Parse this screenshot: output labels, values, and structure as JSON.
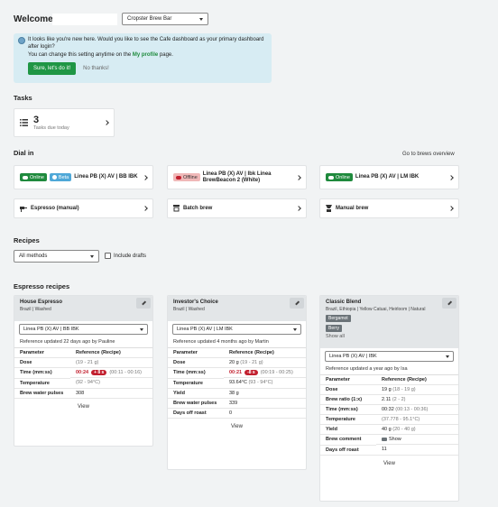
{
  "header": {
    "welcome": "Welcome",
    "location_select": "Cropster Brew Bar"
  },
  "banner": {
    "text1": "It looks like you're new here. Would you like to see the Cafe dashboard as your primary dashboard after login?",
    "text2_prefix": "You can change this setting anytime on the",
    "text2_link": "My profile",
    "text2_suffix": "page.",
    "accept_button": "Sure, let's do it!",
    "decline_button": "No thanks!"
  },
  "tasks": {
    "title": "Tasks",
    "count": "3",
    "label": "Tasks due today"
  },
  "dial_in": {
    "title": "Dial in",
    "overview_link": "Go to brews overview",
    "devices": [
      {
        "badges": [
          "Online",
          "Beta"
        ],
        "name": "Linea PB (X) AV | BB IBK"
      },
      {
        "badges": [
          "Offline"
        ],
        "name": "Linea PB (X) AV | Ibk Linea BrewBeacon 2 (White)"
      },
      {
        "badges": [
          "Online"
        ],
        "name": "Linea PB (X) AV | LM IBK"
      }
    ],
    "manual": [
      {
        "label": "Espresso (manual)"
      },
      {
        "label": "Batch brew"
      },
      {
        "label": "Manual brew"
      }
    ]
  },
  "recipes": {
    "title": "Recipes",
    "filter_select": "All methods",
    "include_drafts": "Include drafts"
  },
  "espresso_recipes": {
    "title": "Espresso recipes",
    "param_header": "Parameter",
    "ref_header": "Reference (Recipe)",
    "view_label": "View",
    "cards": [
      {
        "title": "House Espresso",
        "origin": "Brazil | Washed",
        "machine": "Linea PB (X) AV | BB IBK",
        "updated": "Reference updated 22 days ago by Pauline",
        "rows": [
          {
            "p": "Dose",
            "v": "",
            "r": "(19 - 21 g)"
          },
          {
            "p": "Time (mm:ss)",
            "v": "00:24",
            "badge": "+ 8 s",
            "r": "(00:11 - 00:16)"
          },
          {
            "p": "Temperature",
            "v": "",
            "r": "(92 - 94°C)"
          },
          {
            "p": "Brew water pulses",
            "v": "308",
            "r": ""
          }
        ]
      },
      {
        "title": "Investor's Choice",
        "origin": "Brazil | Washed",
        "machine": "Linea PB (X) AV | LM IBK",
        "updated": "Reference updated 4 months ago by Martin",
        "rows": [
          {
            "p": "Dose",
            "v": "20 g",
            "r": "(19 - 21 g)"
          },
          {
            "p": "Time (mm:ss)",
            "v": "00:21",
            "badge": "-8 s",
            "r": "(00:19 - 00:25)"
          },
          {
            "p": "Temperature",
            "v": "93.64°C",
            "r": "(93 - 94°C)"
          },
          {
            "p": "Yield",
            "v": "38 g",
            "r": ""
          },
          {
            "p": "Brew water pulses",
            "v": "339",
            "r": ""
          },
          {
            "p": "Days off roast",
            "v": "0",
            "r": ""
          }
        ]
      },
      {
        "title": "Classic Blend",
        "origin": "Brazil, Ethiopia | Yellow Catuai, Heirloom | Natural",
        "tags": [
          "Bergamot",
          "Berry"
        ],
        "show_all": "Show all",
        "machine": "Linea PB (X) AV | IBK",
        "updated": "Reference updated a year ago by Isa",
        "rows": [
          {
            "p": "Dose",
            "v": "19 g",
            "r": "(18 - 19 g)"
          },
          {
            "p": "Brew ratio (1:x)",
            "v": "2.11",
            "r": "(2 - 2)"
          },
          {
            "p": "Time (mm:ss)",
            "v": "00:32",
            "r": "(00:13 - 00:36)"
          },
          {
            "p": "Temperature",
            "v": "",
            "r": "(37.778 - 95.1°C)"
          },
          {
            "p": "Yield",
            "v": "40 g",
            "r": "(20 - 40 g)"
          },
          {
            "p": "Brew comment",
            "v": "Show",
            "r": ""
          },
          {
            "p": "Days off roast",
            "v": "11",
            "r": ""
          }
        ]
      }
    ]
  }
}
